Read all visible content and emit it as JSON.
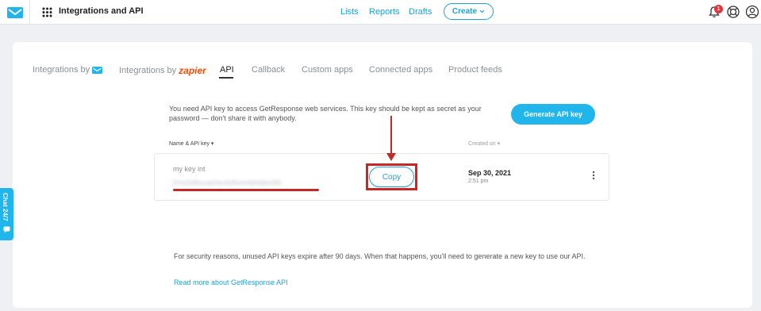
{
  "header": {
    "app_title": "Integrations and API",
    "nav": [
      "Lists",
      "Reports",
      "Drafts"
    ],
    "create_label": "Create",
    "notification_count": "1"
  },
  "tabs": [
    {
      "label": "Integrations by",
      "brand": "getresponse-logo"
    },
    {
      "label": "Integrations by",
      "brand": "zapier"
    },
    {
      "label": "API",
      "active": true
    },
    {
      "label": "Callback"
    },
    {
      "label": "Custom apps"
    },
    {
      "label": "Connected apps"
    },
    {
      "label": "Product feeds"
    }
  ],
  "zapier_text": "zapier",
  "api": {
    "info": "You need API key to access GetResponse web services. This key should be kept as secret as your password — don't share it with anybody.",
    "generate_label": "Generate API key",
    "columns": {
      "name": "Name & API key",
      "created": "Created on"
    },
    "key": {
      "name": "my key int",
      "value": "5me2e85ouaje3ev4yffwsmbbhj9ped6k",
      "copy_label": "Copy",
      "date": "Sep 30, 2021",
      "time": "2:51 pm"
    },
    "security_note": "For security reasons, unused API keys expire after 90 days. When that happens, you'll need to generate a new key to use our API.",
    "read_more": "Read more about GetResponse API"
  },
  "chat": {
    "label": "Chat 24/7"
  },
  "colors": {
    "accent": "#20b5eb",
    "link": "#1ba3d8",
    "annotation": "#c62828",
    "zapier": "#ff4a00"
  }
}
